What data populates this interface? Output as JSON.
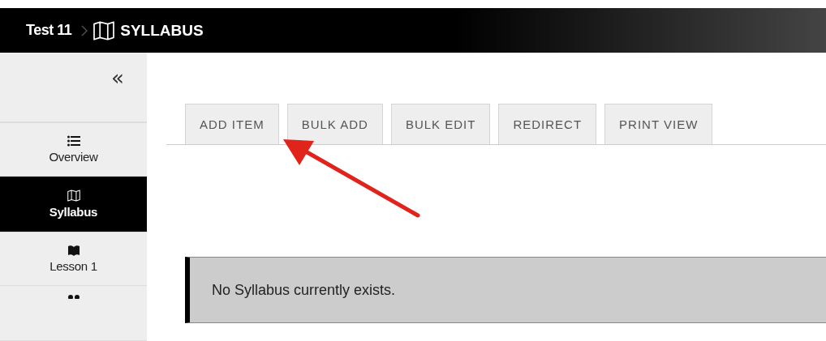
{
  "breadcrumb": {
    "course": "Test 11",
    "page": "SYLLABUS"
  },
  "sidebar": {
    "collapse": "«",
    "items": [
      {
        "kind": "list",
        "label": "Overview",
        "selected": false
      },
      {
        "kind": "map",
        "label": "Syllabus",
        "selected": true
      },
      {
        "kind": "book",
        "label": "Lesson 1",
        "selected": false
      },
      {
        "kind": "people",
        "selected": false
      }
    ]
  },
  "tabs": [
    {
      "label": "ADD ITEM"
    },
    {
      "label": "BULK ADD"
    },
    {
      "label": "BULK EDIT"
    },
    {
      "label": "REDIRECT"
    },
    {
      "label": "PRINT VIEW"
    }
  ],
  "notice": "No Syllabus currently exists.",
  "annotation": {
    "kind": "arrow"
  }
}
